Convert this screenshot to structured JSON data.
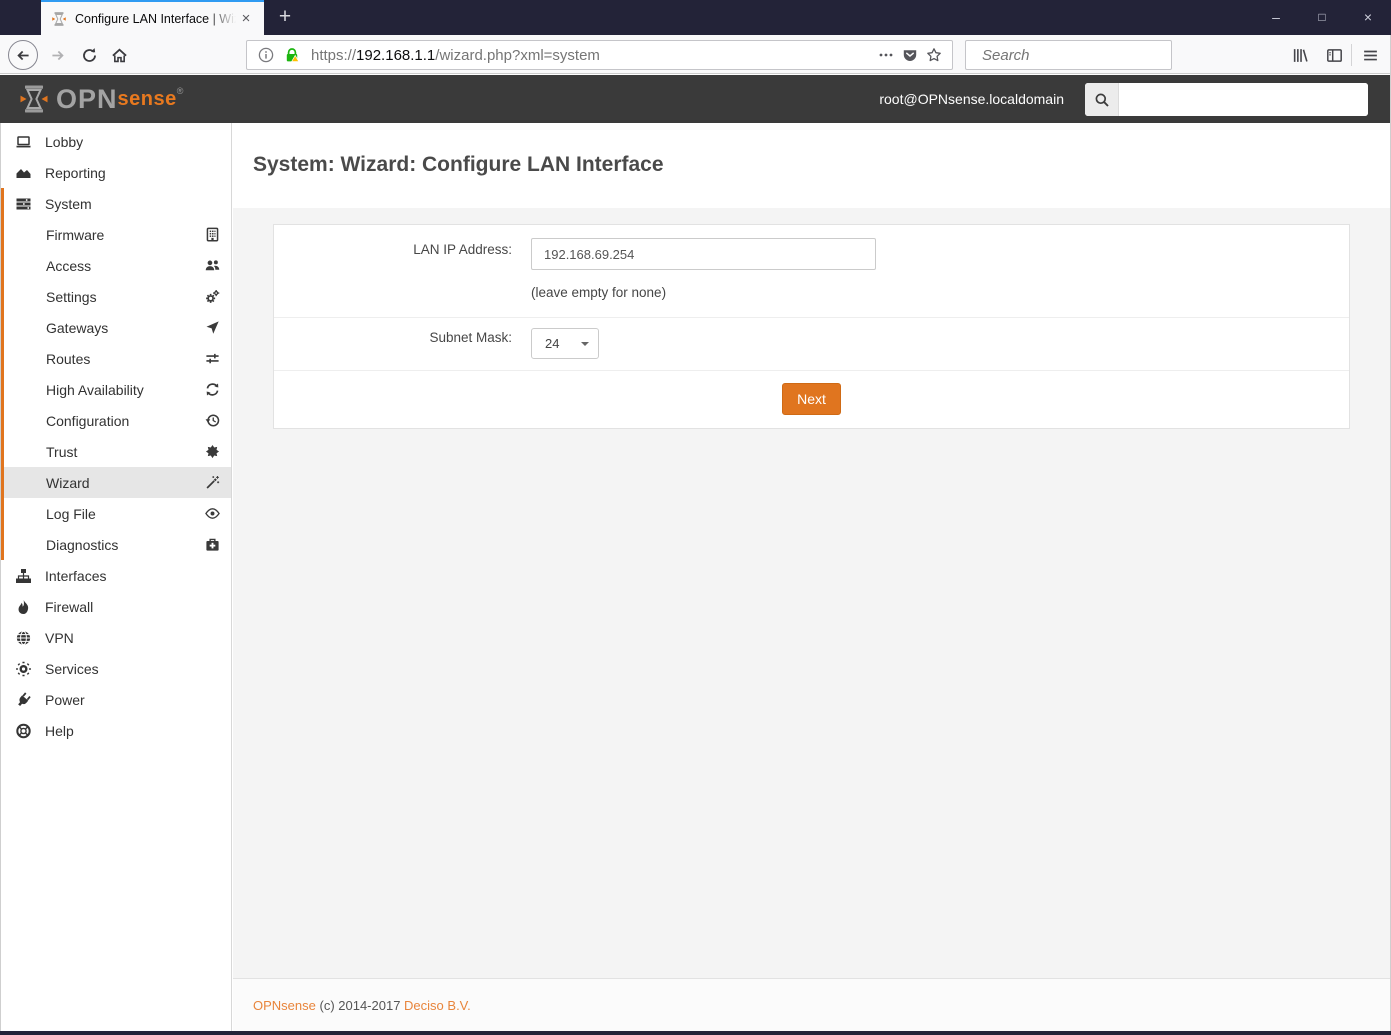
{
  "window": {
    "minimize": "–",
    "maximize": "□",
    "close": "×"
  },
  "browser": {
    "tab": {
      "title": "Configure LAN Interface | Wizar",
      "close": "×",
      "favicon": "opnsense-logo-icon"
    },
    "new_tab": "+",
    "url": {
      "scheme": "https://",
      "host": "192.168.1.1",
      "path": "/wizard.php?xml=system"
    },
    "search_placeholder": "Search"
  },
  "appbar": {
    "logo_opn": "OPN",
    "logo_sense": "sense",
    "logo_reg": "®",
    "user": "root@OPNsense.localdomain"
  },
  "sidebar": {
    "items": [
      {
        "label": "Lobby",
        "icon": "laptop-icon",
        "level": 1
      },
      {
        "label": "Reporting",
        "icon": "area-chart-icon",
        "level": 1
      },
      {
        "label": "System",
        "icon": "tasks-icon",
        "level": 1,
        "group": true
      },
      {
        "label": "Firmware",
        "icon": "building-icon",
        "level": 2,
        "group": true
      },
      {
        "label": "Access",
        "icon": "users-icon",
        "level": 2,
        "group": true
      },
      {
        "label": "Settings",
        "icon": "cogs-icon",
        "level": 2,
        "group": true
      },
      {
        "label": "Gateways",
        "icon": "location-arrow-icon",
        "level": 2,
        "group": true
      },
      {
        "label": "Routes",
        "icon": "routes-icon",
        "level": 2,
        "group": true
      },
      {
        "label": "High Availability",
        "icon": "refresh-icon",
        "level": 2,
        "group": true
      },
      {
        "label": "Configuration",
        "icon": "history-icon",
        "level": 2,
        "group": true
      },
      {
        "label": "Trust",
        "icon": "certificate-icon",
        "level": 2,
        "group": true
      },
      {
        "label": "Wizard",
        "icon": "magic-wand-icon",
        "level": 2,
        "group": true,
        "active": true
      },
      {
        "label": "Log File",
        "icon": "eye-icon",
        "level": 2,
        "group": true
      },
      {
        "label": "Diagnostics",
        "icon": "medkit-icon",
        "level": 2,
        "group": true
      },
      {
        "label": "Interfaces",
        "icon": "sitemap-icon",
        "level": 1
      },
      {
        "label": "Firewall",
        "icon": "fire-icon",
        "level": 1
      },
      {
        "label": "VPN",
        "icon": "globe-icon",
        "level": 1
      },
      {
        "label": "Services",
        "icon": "gear-icon",
        "level": 1
      },
      {
        "label": "Power",
        "icon": "plug-icon",
        "level": 1
      },
      {
        "label": "Help",
        "icon": "life-ring-icon",
        "level": 1
      }
    ]
  },
  "main": {
    "title": "System: Wizard: Configure LAN Interface",
    "form": {
      "lan_ip_label": "LAN IP Address:",
      "lan_ip_value": "192.168.69.254",
      "lan_ip_hint": "(leave empty for none)",
      "subnet_label": "Subnet Mask:",
      "subnet_value": "24",
      "next_label": "Next"
    }
  },
  "footer": {
    "brand": "OPNsense",
    "copyright": " (c) 2014-2017 ",
    "company": "Deciso B.V."
  },
  "colors": {
    "accent_orange": "#e0751f",
    "tab_accent_blue": "#2f9bf2",
    "titlebar_navy": "#232338",
    "appbar_gray": "#3a3a3a",
    "lock_green": "#1db510",
    "warning_yellow": "#ffbf00"
  }
}
